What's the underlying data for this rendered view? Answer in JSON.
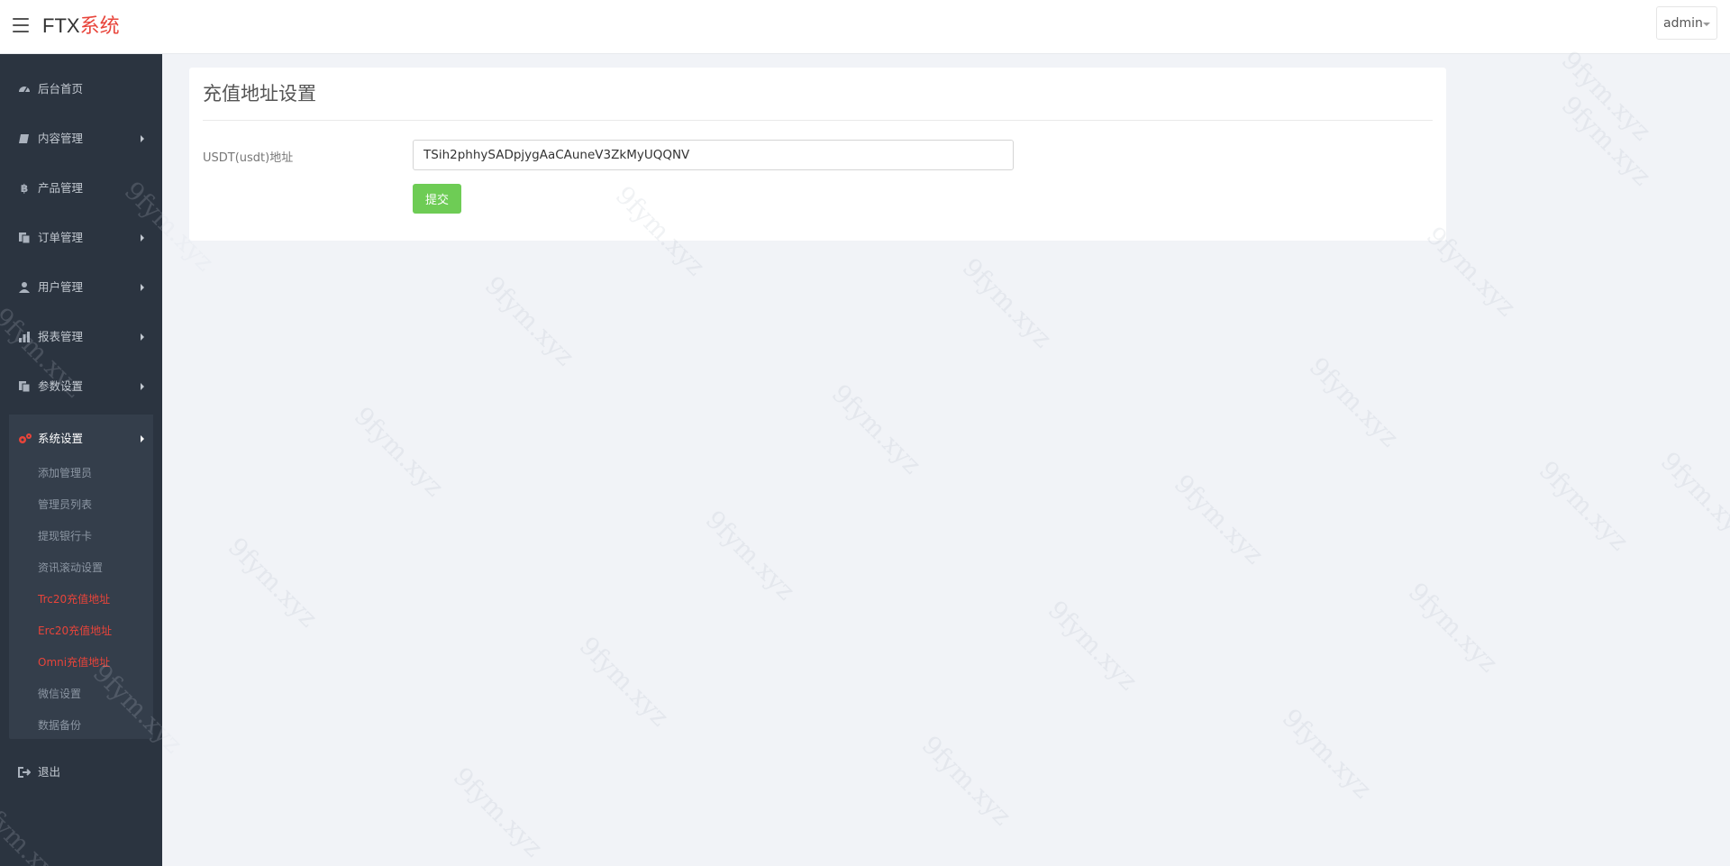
{
  "header": {
    "brand_part1": "FTX",
    "brand_part2": "系统",
    "user": "admin",
    "brand_accent_color": "#e8443a"
  },
  "sidebar": {
    "items": [
      {
        "label": "后台首页",
        "icon": "dashboard-icon"
      },
      {
        "label": "内容管理",
        "icon": "book-icon"
      },
      {
        "label": "产品管理",
        "icon": "bitcoin-icon"
      },
      {
        "label": "订单管理",
        "icon": "copy-icon"
      },
      {
        "label": "用户管理",
        "icon": "user-icon"
      },
      {
        "label": "报表管理",
        "icon": "chart-icon"
      },
      {
        "label": "参数设置",
        "icon": "copy-icon"
      },
      {
        "label": "系统设置",
        "icon": "gears-icon"
      }
    ],
    "submenu": [
      "添加管理员",
      "管理员列表",
      "提现银行卡",
      "资讯滚动设置",
      "Trc20充值地址",
      "Erc20充值地址",
      "Omni充值地址",
      "微信设置",
      "数据备份"
    ],
    "logout": "退出"
  },
  "panel": {
    "title": "充值地址设置",
    "field_label": "USDT(usdt)地址",
    "field_value": "TSih2phhySADpjygAaCAuneV3ZkMyUQQNV",
    "submit_label": "提交"
  },
  "watermark": "9fym.xyz"
}
